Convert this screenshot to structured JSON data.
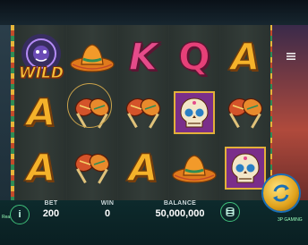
{
  "reels": [
    [
      {
        "symbol": "wild-dreamcatcher",
        "label": "WILD"
      },
      {
        "symbol": "A",
        "label": "A"
      },
      {
        "symbol": "A",
        "label": "A"
      }
    ],
    [
      {
        "symbol": "sombrero",
        "label": ""
      },
      {
        "symbol": "maracas",
        "label": ""
      },
      {
        "symbol": "maracas",
        "label": ""
      }
    ],
    [
      {
        "symbol": "K",
        "label": "K"
      },
      {
        "symbol": "maracas",
        "label": ""
      },
      {
        "symbol": "A",
        "label": "A"
      }
    ],
    [
      {
        "symbol": "Q",
        "label": "Q"
      },
      {
        "symbol": "sugar-skull",
        "label": ""
      },
      {
        "symbol": "sombrero",
        "label": ""
      }
    ],
    [
      {
        "symbol": "A",
        "label": "A"
      },
      {
        "symbol": "maracas",
        "label": ""
      },
      {
        "symbol": "sugar-skull",
        "label": ""
      }
    ]
  ],
  "hud": {
    "bet_label": "BET",
    "bet_value": "200",
    "win_label": "WIN",
    "win_value": "0",
    "balance_label": "BALANCE",
    "balance_value": "50,000,000",
    "brand": "3P GAMING",
    "left_tag": "Real"
  },
  "icons": {
    "info": "info-icon",
    "coins": "coin-stack-icon",
    "spin": "autospin-arrows-icon",
    "settings": "menu-icon"
  },
  "colors": {
    "letter_orange": "#f5b22a",
    "letter_pink": "#e54b8a",
    "accent_green": "#3fbf7a",
    "spin_blue": "#1b6fb6"
  }
}
